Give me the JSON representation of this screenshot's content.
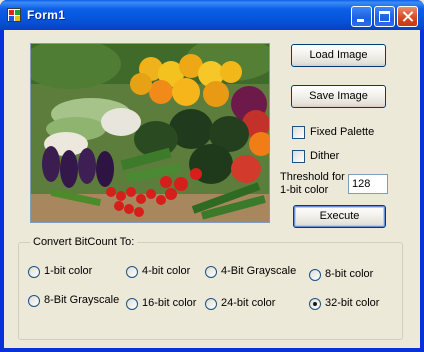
{
  "window": {
    "title": "Form1"
  },
  "buttons": {
    "load": "Load Image",
    "save": "Save Image",
    "execute": "Execute"
  },
  "options": {
    "fixed_palette": {
      "label": "Fixed Palette",
      "checked": false
    },
    "dither": {
      "label": "Dither",
      "checked": false
    }
  },
  "threshold": {
    "label_line1": "Threshold for",
    "label_line2": "1-bit color",
    "value": "128"
  },
  "convert": {
    "group_label": "Convert BitCount To:",
    "options": [
      {
        "label": "1-bit color",
        "selected": false
      },
      {
        "label": "4-bit color",
        "selected": false
      },
      {
        "label": "4-Bit Grayscale",
        "selected": false
      },
      {
        "label": "8-bit color",
        "selected": false
      },
      {
        "label": "8-Bit Grayscale",
        "selected": false
      },
      {
        "label": "16-bit color",
        "selected": false
      },
      {
        "label": "24-bit color",
        "selected": false
      },
      {
        "label": "32-bit color",
        "selected": true
      }
    ]
  },
  "icons": {
    "app": "windows-form-icon",
    "minimize": "minimize-icon",
    "maximize": "maximize-icon",
    "close": "close-icon"
  },
  "colors": {
    "titlebar": "#0553d8",
    "close_button": "#d4471f",
    "form_background": "#ece9d8"
  }
}
